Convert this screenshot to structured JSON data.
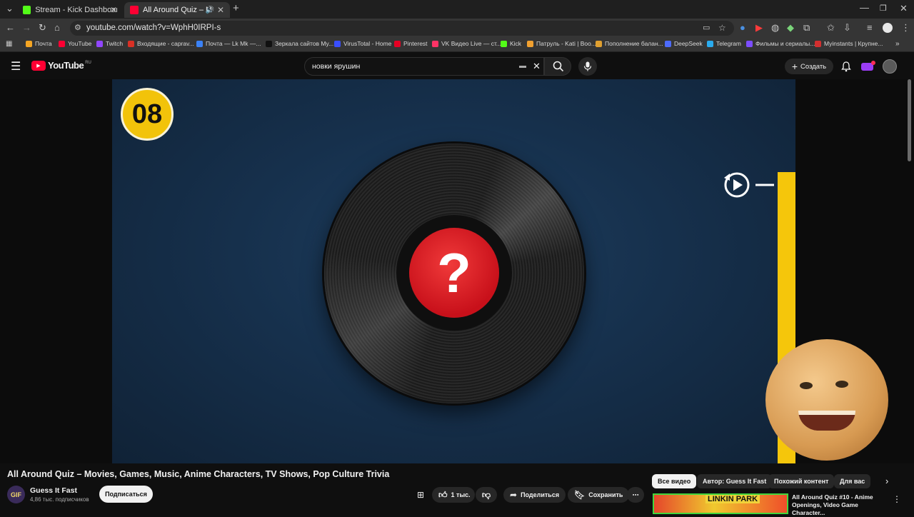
{
  "browser": {
    "tabs": [
      {
        "title": "Stream - Kick Dashboard",
        "favicon_color": "#53fc18",
        "active": false
      },
      {
        "title": "All Around Quiz – Movies, G",
        "favicon_color": "#ff0033",
        "active": true
      }
    ],
    "url": "youtube.com/watch?v=WphH0IRPI-s",
    "bookmarks": [
      {
        "label": "Почта",
        "color": "#f5a623"
      },
      {
        "label": "YouTube",
        "color": "#ff0033"
      },
      {
        "label": "Twitch",
        "color": "#9146ff"
      },
      {
        "label": "Входящие - caprav...",
        "color": "#d93025"
      },
      {
        "label": "Почта — Lk Mk —...",
        "color": "#3b82f6"
      },
      {
        "label": "Зеркала сайтов My...",
        "color": "#111111"
      },
      {
        "label": "VirusTotal - Home",
        "color": "#394eff"
      },
      {
        "label": "Pinterest",
        "color": "#e60023"
      },
      {
        "label": "VK Видео Live — ст...",
        "color": "#ff3366"
      },
      {
        "label": "Kick",
        "color": "#53fc18"
      },
      {
        "label": "Патруль - Kati | Boo...",
        "color": "#f0a030"
      },
      {
        "label": "Пополнение балан...",
        "color": "#e0a030"
      },
      {
        "label": "DeepSeek",
        "color": "#4d6bfe"
      },
      {
        "label": "Telegram",
        "color": "#2aabee"
      },
      {
        "label": "Фильмы и сериалы...",
        "color": "#7c4dff"
      },
      {
        "label": "Myinstants | Крупне...",
        "color": "#d32f2f"
      }
    ]
  },
  "youtube": {
    "logo_text": "YouTube",
    "region": "RU",
    "search_query": "новки ярушин",
    "create_label": "Создать"
  },
  "video": {
    "question_number": "08",
    "title": "All Around Quiz – Movies, Games, Music, Anime Characters, TV Shows, Pop Culture Trivia",
    "channel_initials": "GIF",
    "channel_name": "Guess It Fast",
    "subscribers": "4,86 тыс. подписчиков",
    "subscribe_label": "Подписаться",
    "likes": "1 тыс.",
    "share_label": "Поделиться",
    "save_label": "Сохранить",
    "timer_remaining": 1.0
  },
  "chips": [
    {
      "label": "Все видео",
      "active": true
    },
    {
      "label": "Автор: Guess It Fast",
      "active": false
    },
    {
      "label": "Похожий контент",
      "active": false
    },
    {
      "label": "Для вас",
      "active": false
    }
  ],
  "recommendation": {
    "thumb_text": "LINKIN PARK",
    "title": "All Around Quiz #10 - Anime Openings, Video Game Character..."
  }
}
